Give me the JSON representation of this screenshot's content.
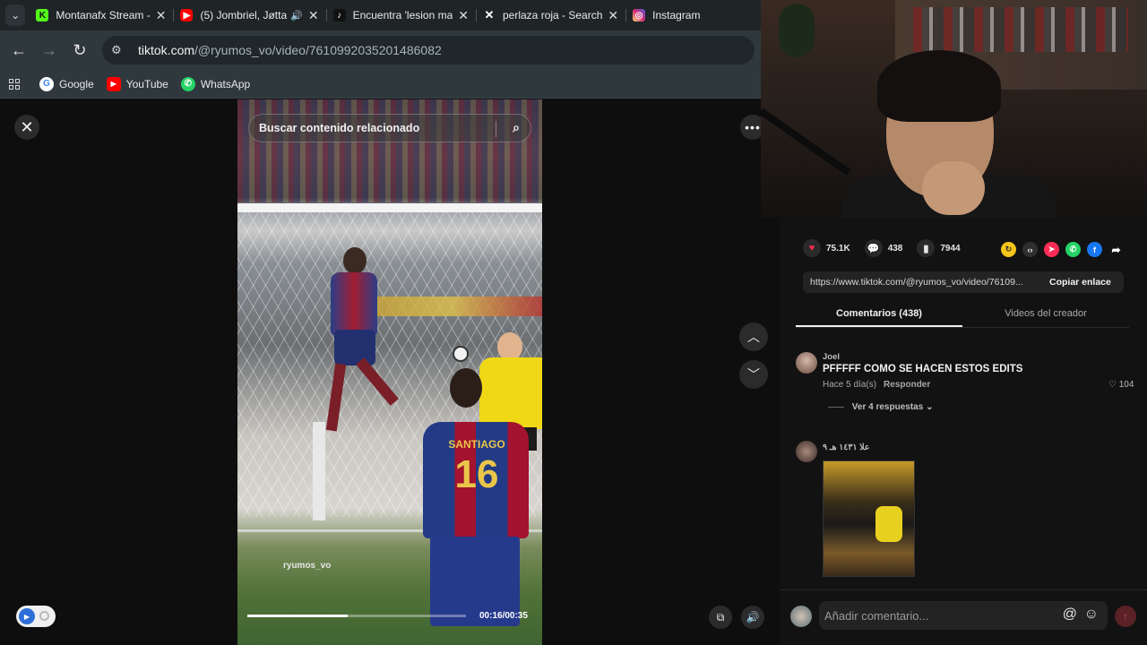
{
  "browser": {
    "tabs": [
      {
        "title": "Montanafx Stream -",
        "favicon": "kick-icon",
        "color": "#53fc18",
        "glyph": "K"
      },
      {
        "title": "(5) Jombriel, Jøtta",
        "favicon": "youtube-icon",
        "color": "#ff0000",
        "glyph": "▶",
        "audio": "speaker-icon"
      },
      {
        "title": "Encuentra 'lesion ma",
        "favicon": "tiktok-icon",
        "color": "#111111",
        "glyph": "♪"
      },
      {
        "title": "perlaza roja - Search",
        "favicon": "x-icon",
        "color": "#111111",
        "glyph": "𝕏"
      },
      {
        "title": "Instagram",
        "favicon": "instagram-icon",
        "color": "#d62976",
        "glyph": "◎"
      }
    ],
    "url_host": "tiktok.com",
    "url_path": "/@ryumos_vo/video/7610992035201486082",
    "bookmarks": [
      {
        "label": "Google",
        "icon": "google-icon"
      },
      {
        "label": "YouTube",
        "icon": "youtube-icon"
      },
      {
        "label": "WhatsApp",
        "icon": "whatsapp-icon"
      }
    ]
  },
  "video": {
    "search_placeholder": "Buscar contenido relacionado",
    "watermark": "ryumos_vo",
    "time": "00:16/00:35",
    "progress": 0.46,
    "jersey_name": "SANTIAGO",
    "jersey_number": "16"
  },
  "stats": {
    "likes": "75.1K",
    "comments": "438",
    "saves": "7944"
  },
  "share_link": {
    "url": "https://www.tiktok.com/@ryumos_vo/video/76109...",
    "copy_label": "Copiar enlace"
  },
  "panel_tabs": {
    "comments": "Comentarios (438)",
    "creator_videos": "Videos del creador"
  },
  "comments": [
    {
      "user": "Joel",
      "text": "PFFFFF COMO SE HACEN ESTOS EDITS",
      "time": "Hace 5 día(s)",
      "reply": "Responder",
      "likes": "104",
      "replies": "Ver 4 respuestas"
    },
    {
      "user": "علا ١٤٣١ هـ ٩",
      "text": "",
      "time": "",
      "reply": ""
    }
  ],
  "composer": {
    "placeholder": "Añadir comentario..."
  },
  "colors": {
    "like": "#fe2c55",
    "accent": "#fe2c55"
  }
}
